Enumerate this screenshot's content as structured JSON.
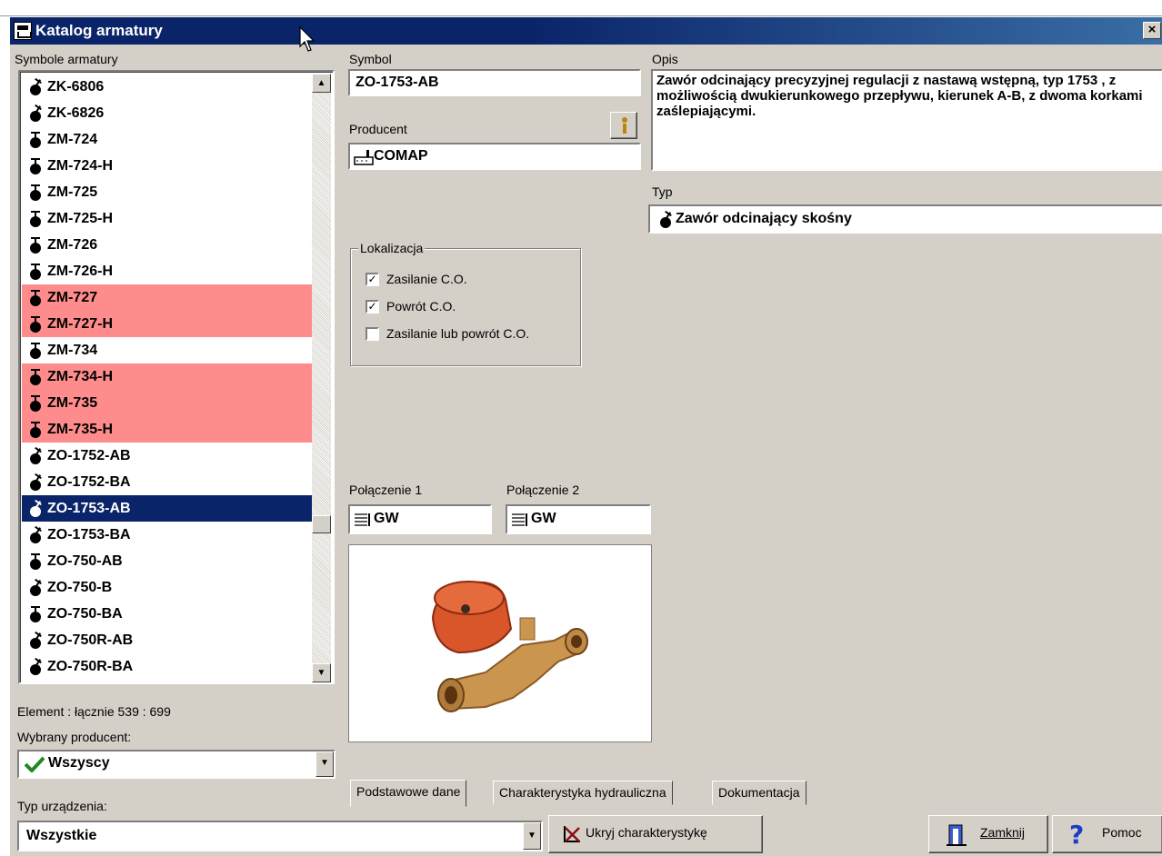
{
  "window": {
    "title": "Katalog armatury",
    "close_label": "×"
  },
  "labels": {
    "list_header": "Symbole armatury",
    "symbol": "Symbol",
    "opis": "Opis",
    "producent": "Producent",
    "typ": "Typ",
    "lokalizacja": "Lokalizacja",
    "polaczenie1": "Połączenie 1",
    "polaczenie2": "Połączenie 2",
    "element_count": "Element : łącznie  539 : 699",
    "wybrany_producent": "Wybrany producent:",
    "typ_urzadzenia": "Typ urządzenia:"
  },
  "list": {
    "items": [
      {
        "label": "ZK-6806",
        "icon": "skos",
        "state": "normal"
      },
      {
        "label": "ZK-6826",
        "icon": "skos",
        "state": "normal"
      },
      {
        "label": "ZM-724",
        "icon": "prosty",
        "state": "normal"
      },
      {
        "label": "ZM-724-H",
        "icon": "prosty",
        "state": "normal"
      },
      {
        "label": "ZM-725",
        "icon": "prosty",
        "state": "normal"
      },
      {
        "label": "ZM-725-H",
        "icon": "prosty",
        "state": "normal"
      },
      {
        "label": "ZM-726",
        "icon": "prosty",
        "state": "normal"
      },
      {
        "label": "ZM-726-H",
        "icon": "prosty",
        "state": "normal"
      },
      {
        "label": "ZM-727",
        "icon": "prosty",
        "state": "red"
      },
      {
        "label": "ZM-727-H",
        "icon": "prosty",
        "state": "red"
      },
      {
        "label": "ZM-734",
        "icon": "prosty",
        "state": "normal"
      },
      {
        "label": "ZM-734-H",
        "icon": "prosty",
        "state": "red"
      },
      {
        "label": "ZM-735",
        "icon": "prosty",
        "state": "red"
      },
      {
        "label": "ZM-735-H",
        "icon": "prosty",
        "state": "red"
      },
      {
        "label": "ZO-1752-AB",
        "icon": "skos",
        "state": "normal"
      },
      {
        "label": "ZO-1752-BA",
        "icon": "skos",
        "state": "normal"
      },
      {
        "label": "ZO-1753-AB",
        "icon": "skos",
        "state": "selected"
      },
      {
        "label": "ZO-1753-BA",
        "icon": "skos",
        "state": "normal"
      },
      {
        "label": "ZO-750-AB",
        "icon": "prosty",
        "state": "normal"
      },
      {
        "label": "ZO-750-B",
        "icon": "skos",
        "state": "normal"
      },
      {
        "label": "ZO-750-BA",
        "icon": "prosty",
        "state": "normal"
      },
      {
        "label": "ZO-750R-AB",
        "icon": "skos",
        "state": "normal"
      },
      {
        "label": "ZO-750R-BA",
        "icon": "skos",
        "state": "normal"
      }
    ]
  },
  "fields": {
    "symbol": "ZO-1753-AB",
    "producent": "COMAP",
    "opis": "Zawór odcinający precyzyjnej regulacji z nastawą wstępną, typ 1753 , z możliwością dwukierunkowego przepływu, kierunek A-B, z dwoma korkami zaślepiającymi.",
    "typ": "Zawór odcinający skośny",
    "polaczenie1": "GW",
    "polaczenie2": "GW",
    "wybrany_producent": "Wszyscy",
    "typ_urzadzenia": "Wszystkie"
  },
  "lokalizacja": [
    {
      "label": "Zasilanie C.O.",
      "checked": true
    },
    {
      "label": "Powrót C.O.",
      "checked": true
    },
    {
      "label": "Zasilanie lub powrót C.O.",
      "checked": false
    }
  ],
  "tabs": [
    "Podstawowe dane",
    "Charakterystyka hydrauliczna",
    "Dokumentacja"
  ],
  "buttons": {
    "ukryj": "Ukryj charakterystykę",
    "zamknij": "Zamknij",
    "pomoc": "Pomoc"
  },
  "colors": {
    "selection": "#0a246a",
    "highlight_red": "#ff8c8c",
    "window_bg": "#d4d0c8",
    "checkmark_green": "#1f8a1f",
    "help_blue": "#1a3cc8"
  }
}
